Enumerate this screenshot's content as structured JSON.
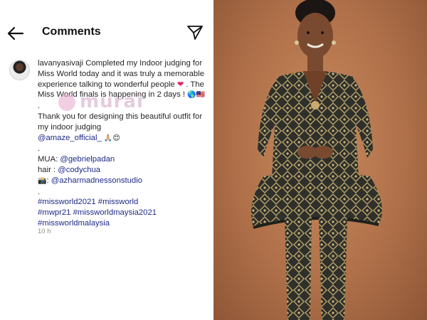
{
  "header": {
    "title": "Comments",
    "back_icon": "arrow-left-icon",
    "send_icon": "paper-plane-icon"
  },
  "post": {
    "username": "lavanyasivaji",
    "text_1": " Completed my Indoor judging for Miss World today and it was truly a memorable experience talking to wonderful people ",
    "text_2": " . The Miss World finals is happening in 2 days ! ",
    "emoji_heart": "❤",
    "emoji_globe": "🌎🇲🇾",
    "dot_1": ".",
    "line_thanks": "Thank you for designing this beautiful outfit for my indoor judging",
    "mention_amaze": "@amaze_official_",
    "emoji_thanks": "🙏🏼😊",
    "dot_2": ".",
    "mua_label": "MUA: ",
    "mua_handle": "@gebrielpadan",
    "hair_label": "hair : ",
    "hair_handle": "@codychua",
    "camera_emoji": "📸",
    "photo_sep": ": ",
    "photo_handle": "@azharmadnessonstudio",
    "dot_3": ".",
    "hashtags": [
      "#missworld2021",
      "#missworld",
      "#mwpr21",
      "#missworldmaysia2021",
      "#missworldmalaysia"
    ],
    "time_ago": "10 h"
  },
  "watermark": {
    "text": "murai"
  },
  "photo": {
    "subject": "woman in gold patterned peplum jacket and trousers",
    "colors": {
      "background": "#b5754c",
      "outfit_dark": "#2e2f2a",
      "outfit_gold": "#b9a36a",
      "skin": "#7a4a30"
    }
  }
}
